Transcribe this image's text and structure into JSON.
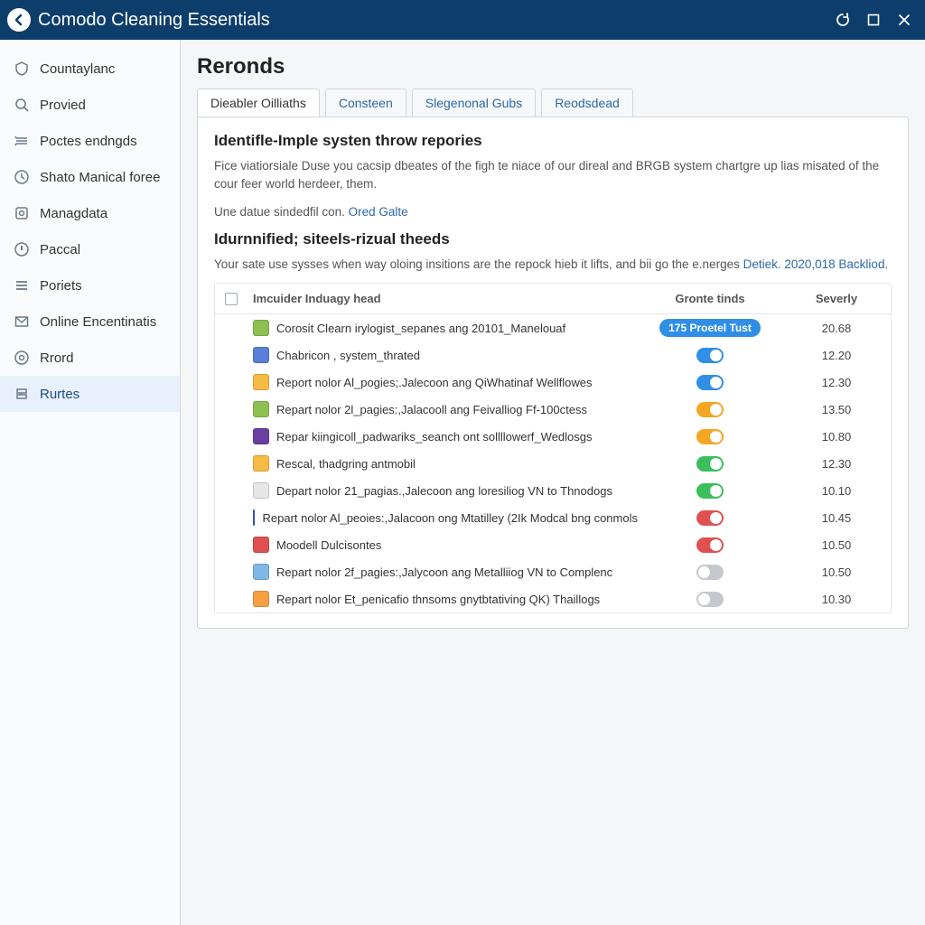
{
  "titlebar": {
    "title": "Comodo Cleaning Essentials"
  },
  "sidebar": {
    "items": [
      {
        "label": "Countaylanc"
      },
      {
        "label": "Provied"
      },
      {
        "label": "Poctes endngds"
      },
      {
        "label": "Shato Manical foree"
      },
      {
        "label": "Managdata"
      },
      {
        "label": "Paccal"
      },
      {
        "label": "Poriets"
      },
      {
        "label": "Online Encentinatis"
      },
      {
        "label": "Rrord"
      },
      {
        "label": "Rurtes"
      }
    ]
  },
  "page": {
    "title": "Reronds"
  },
  "tabs": [
    {
      "label": "Dieabler Oilliaths"
    },
    {
      "label": "Consteen"
    },
    {
      "label": "Slegenonal Gubs"
    },
    {
      "label": "Reodsdead"
    }
  ],
  "section1": {
    "heading": "Identifle-Imple systen throw repories",
    "desc": "Fice viatiorsiale Duse you cacsip dbeates of the figh te niace of our direal and BRGB system chartgre up lias misated of the cour feer world herdeer, them.",
    "note_prefix": "Une datue sindedfil con. ",
    "note_link": "Ored Galte"
  },
  "section2": {
    "heading": "Idurnnified; siteels-rizual theeds",
    "desc_prefix": "Your sate use sysses when way oloing insitions are the repock hieb it lifts, and bii go the e.nerges ",
    "desc_link": "Detiek. 2020,018 Backliod."
  },
  "table": {
    "cols": {
      "c1": "Imcuider Induagy head",
      "c2": "Gronte tinds",
      "c3": "Severly"
    },
    "rows": [
      {
        "ico": "#8cc152",
        "name": "Corosit Clearn irylogist_sepanes ang 20101_Manelouaf",
        "badge": "175 Proetel Tust",
        "sev": "20.68"
      },
      {
        "ico": "#5b7fd6",
        "name": "Chabricon , system_thrated",
        "toggle": "on",
        "tc": "tg-blue",
        "sev": "12.20"
      },
      {
        "ico": "#f6bb42",
        "name": "Report nolor Al_pogies;.Jalecoon ang QiWhatinaf Wellflowes",
        "toggle": "on",
        "tc": "tg-blue",
        "sev": "12.30"
      },
      {
        "ico": "#8cc152",
        "name": "Repart nolor 2l_pagies:,Jalacooll ang Feivalliog Ff-100ctess",
        "toggle": "on",
        "tc": "tg-orange",
        "sev": "13.50"
      },
      {
        "ico": "#6a3fa0",
        "name": "Repar kiingicoll_padwariks_seanch ont sollllowerf_Wedlosgs",
        "toggle": "on",
        "tc": "tg-orange",
        "sev": "10.80"
      },
      {
        "ico": "#f6bb42",
        "name": "Rescal, thadgring antmobil",
        "toggle": "on",
        "tc": "tg-green",
        "sev": "12.30"
      },
      {
        "ico": "#e6e6e6",
        "name": "Depart nolor 21_pagias.,Jalecoon ang loresiliog VN to Thnodogs",
        "toggle": "on",
        "tc": "tg-green",
        "sev": "10.10"
      },
      {
        "ico": "#3b5fd6",
        "name": "Repart nolor Al_peoies:,Jalacoon ong Mtatilley (2Ik Modcal bng conmols",
        "toggle": "on",
        "tc": "tg-red",
        "sev": "10.45"
      },
      {
        "ico": "#e05050",
        "name": "Moodell Dulcisontes",
        "toggle": "on",
        "tc": "tg-red",
        "sev": "10.50"
      },
      {
        "ico": "#7fb8e6",
        "name": "Repart nolor 2f_pagies:,Jalycoon ang Metalliiog VN to Complenc",
        "toggle": "off",
        "tc": "tg-grey",
        "sev": "10.50"
      },
      {
        "ico": "#f6a042",
        "name": "Repart nolor Et_penicafio thnsoms gnytbtativing QK) Thaillogs",
        "toggle": "off",
        "tc": "tg-grey",
        "sev": "10.30"
      }
    ]
  }
}
